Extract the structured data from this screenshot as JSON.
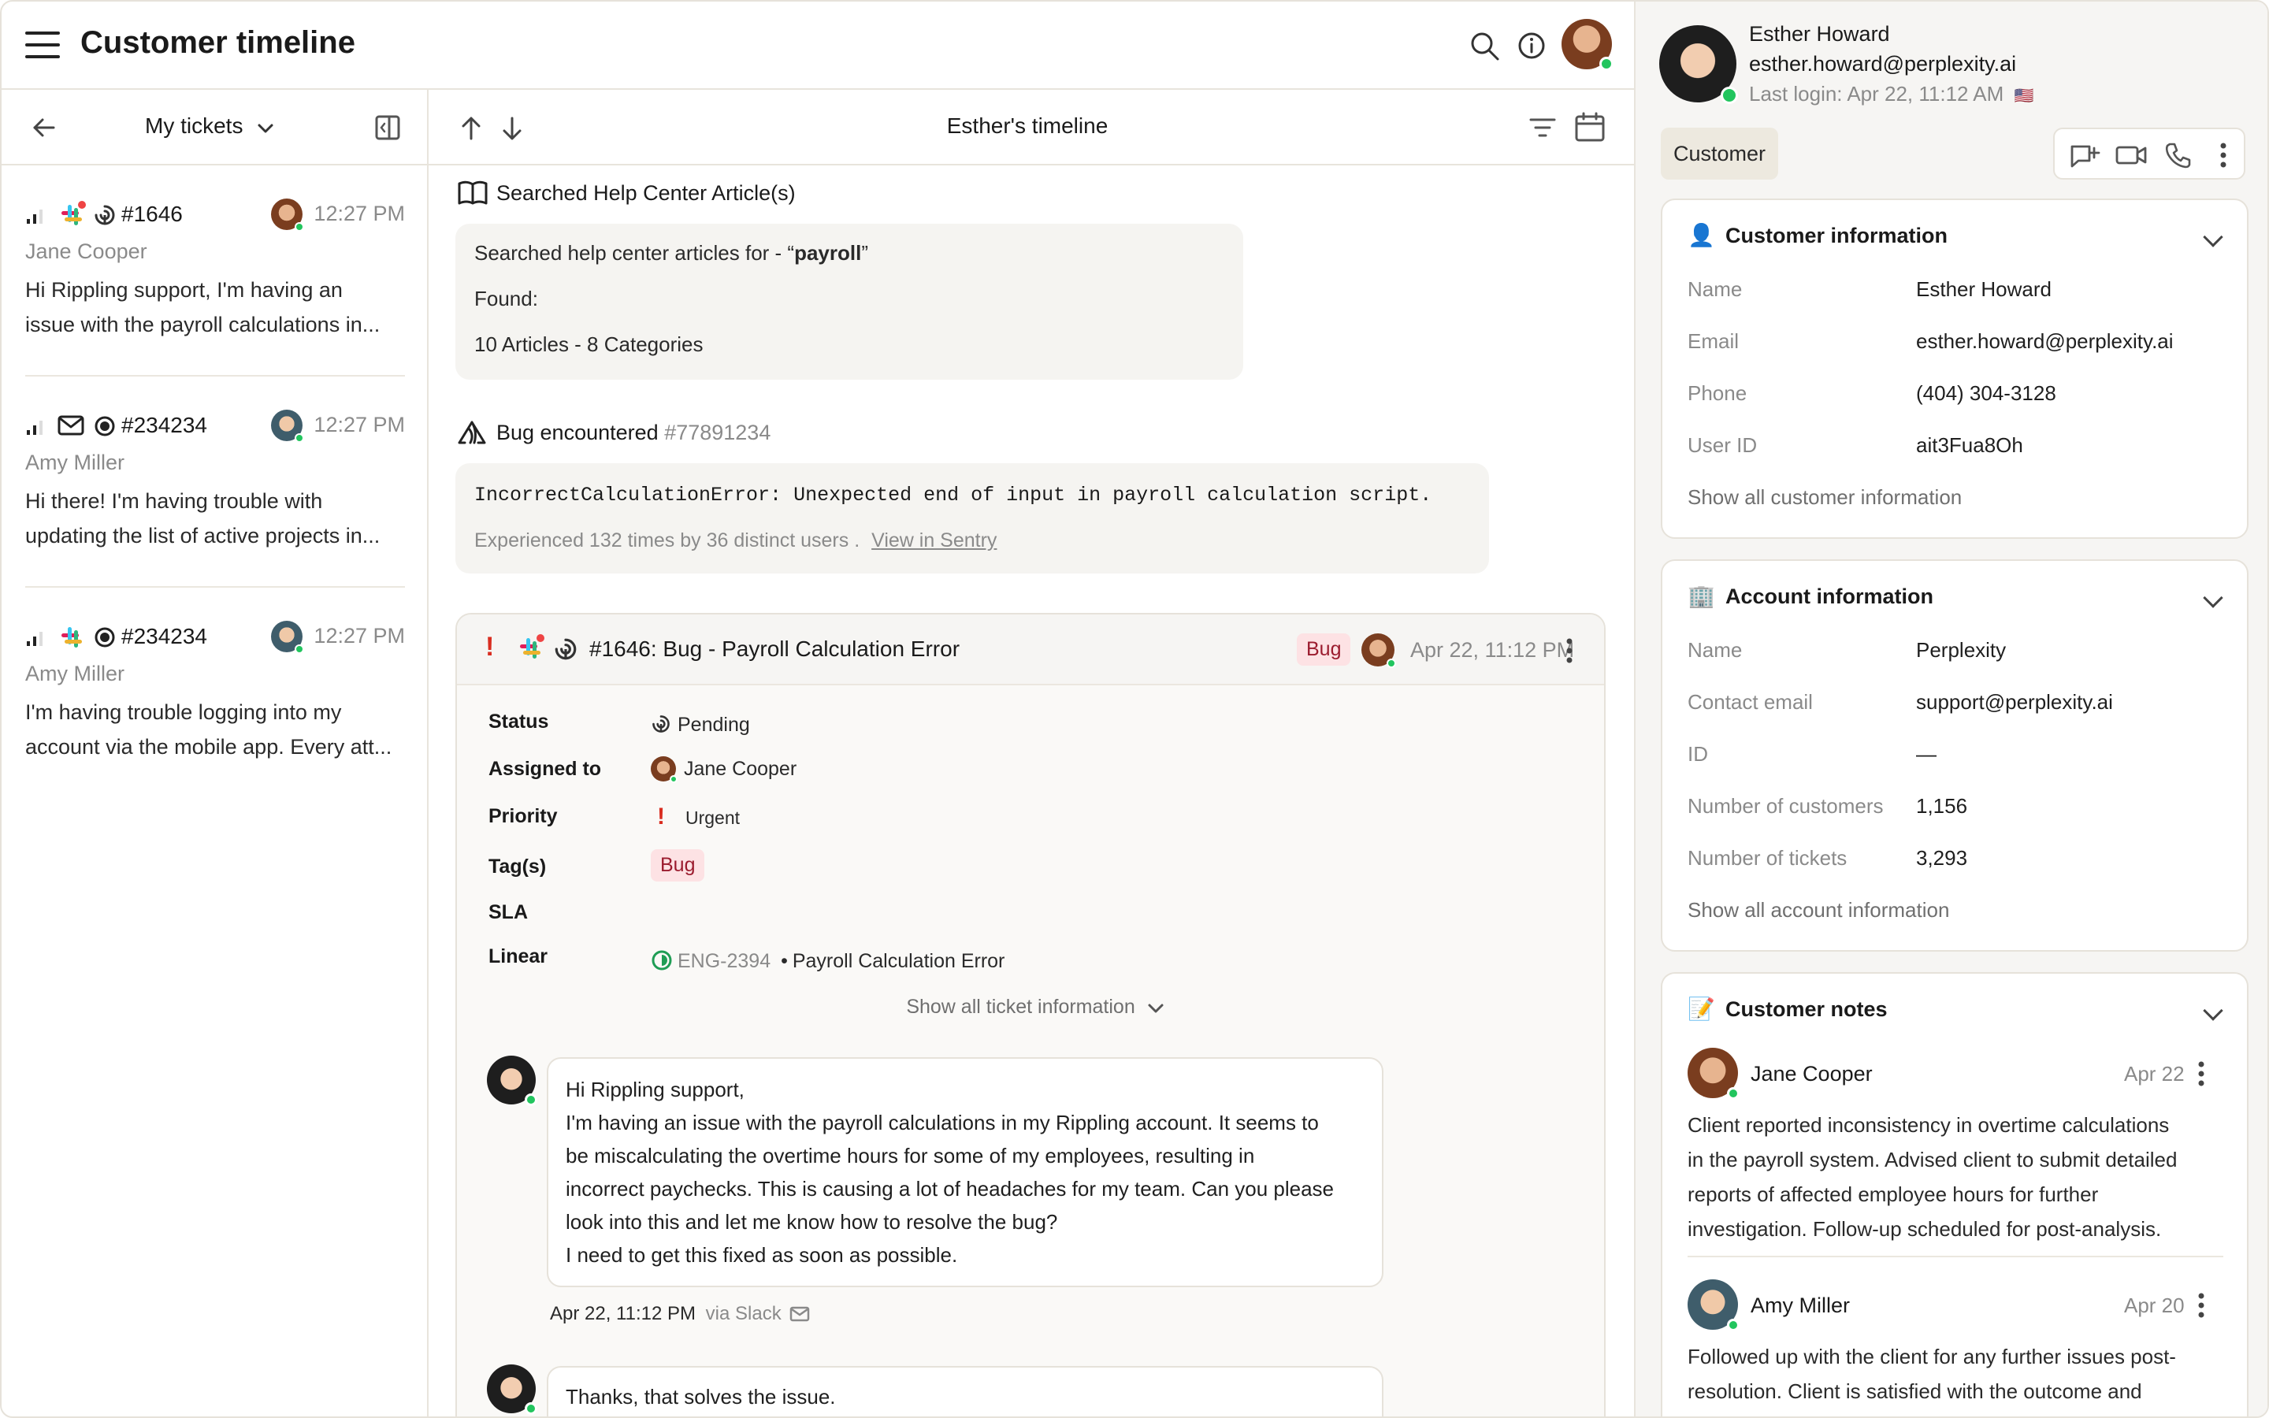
{
  "header": {
    "title": "Customer timeline"
  },
  "left_panel": {
    "filter_label": "My tickets",
    "tickets": [
      {
        "number": "#1646",
        "time": "12:27 PM",
        "customer": "Jane Cooper",
        "snippet_line1": "Hi Rippling support, I'm having an",
        "snippet_line2": "issue with the payroll calculations in...",
        "channel": "slack-icon"
      },
      {
        "number": "#234234",
        "time": "12:27 PM",
        "customer": "Amy Miller",
        "snippet_line1": "Hi there! I'm having trouble with",
        "snippet_line2": "updating the list of active projects in...",
        "channel": "mail-icon"
      },
      {
        "number": "#234234",
        "time": "12:27 PM",
        "customer": "Amy Miller",
        "snippet_line1": "I'm having trouble logging into my",
        "snippet_line2": "account via the mobile app. Every att...",
        "channel": "slack-icon"
      }
    ]
  },
  "timeline": {
    "title": "Esther's timeline",
    "help_search": {
      "title": "Searched Help Center Article(s)",
      "line1_prefix": "Searched help center articles for - “",
      "query": "payroll",
      "line1_suffix": "”",
      "found_label": "Found:",
      "result": "10 Articles - 8 Categories"
    },
    "bug": {
      "title": "Bug encountered",
      "id": "#77891234",
      "error": "IncorrectCalculationError: Unexpected end of input in payroll calculation script.",
      "experienced": "Experienced 132 times by 36 distinct users .",
      "sentry_link": "View in Sentry"
    },
    "ticket": {
      "title": "#1646: Bug - Payroll Calculation Error",
      "tag": "Bug",
      "timestamp": "Apr 22, 11:12 PM",
      "fields": {
        "status_label": "Status",
        "status_value": "Pending",
        "assigned_label": "Assigned to",
        "assigned_value": "Jane Cooper",
        "priority_label": "Priority",
        "priority_value": "Urgent",
        "tags_label": "Tag(s)",
        "tags_value": "Bug",
        "sla_label": "SLA",
        "linear_label": "Linear",
        "linear_id": "ENG-2394",
        "linear_sep": "•",
        "linear_title": "Payroll Calculation Error"
      },
      "show_all": "Show all ticket information",
      "message1": {
        "lines": [
          "Hi Rippling support,",
          "I'm having an issue with the payroll calculations in my Rippling account. It seems to",
          "be miscalculating the overtime hours for some of my employees, resulting in",
          "incorrect paychecks. This is causing a lot of headaches for my team. Can you please",
          "look into this and let me know how to resolve the bug?",
          "I need to get this fixed as soon as possible."
        ],
        "timestamp": "Apr 22, 11:12 PM",
        "via": "via Slack"
      },
      "message2": {
        "text": "Thanks, that solves the issue."
      }
    }
  },
  "customer": {
    "name": "Esther Howard",
    "email": "esther.howard@perplexity.ai",
    "last_login": "Last login: Apr 22, 11:12 AM",
    "flag": "🇺🇸",
    "badge": "Customer",
    "info": {
      "title": "Customer information",
      "name_label": "Name",
      "name_value": "Esther Howard",
      "email_label": "Email",
      "email_value": "esther.howard@perplexity.ai",
      "phone_label": "Phone",
      "phone_value": "(404) 304-3128",
      "userid_label": "User ID",
      "userid_value": "ait3Fua8Oh",
      "show_all": "Show all customer information"
    },
    "account": {
      "title": "Account information",
      "name_label": "Name",
      "name_value": "Perplexity",
      "contact_label": "Contact email",
      "contact_value": "support@perplexity.ai",
      "id_label": "ID",
      "id_value": "—",
      "customers_label": "Number of customers",
      "customers_value": "1,156",
      "tickets_label": "Number of tickets",
      "tickets_value": "3,293",
      "show_all": "Show all account information"
    },
    "notes": {
      "title": "Customer notes",
      "items": [
        {
          "author": "Jane Cooper",
          "date": "Apr 22",
          "lines": [
            "Client reported inconsistency in overtime calculations",
            "in the payroll system. Advised client to submit detailed",
            "reports of affected employee hours for further",
            "investigation. Follow-up scheduled for post-analysis."
          ]
        },
        {
          "author": "Amy Miller",
          "date": "Apr 20",
          "lines": [
            "Followed up with the client for any further issues post-",
            "resolution. Client is satisfied with the outcome and"
          ]
        }
      ]
    }
  },
  "colors": {
    "accent_bg": "#ede9df",
    "online": "#22c55e",
    "bug_tag_bg": "#fde2e4",
    "urgent": "#d92d20",
    "linear_green": "#1f9d55"
  }
}
